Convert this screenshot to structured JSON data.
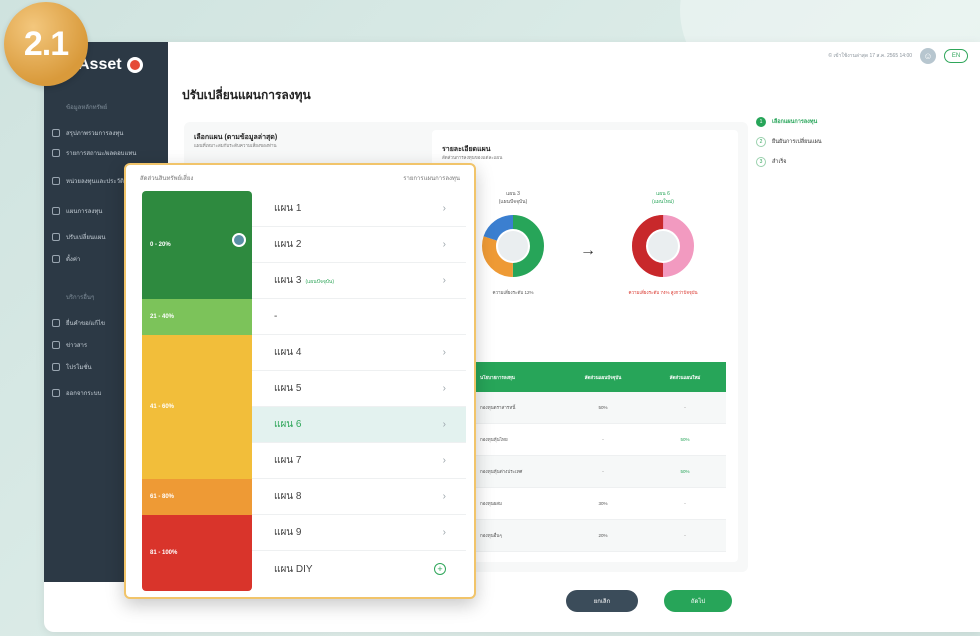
{
  "step_badge": "2.1",
  "app": {
    "logo_text": "Asset"
  },
  "header": {
    "last_login": "© เข้าใช้งานล่าสุด 17 ส.ค. 2565 14:00",
    "lang": "EN"
  },
  "sidebar": {
    "section1": "ข้อมูลหลักทรัพย์",
    "items": [
      {
        "label": "สรุปภาพรวมการลงทุน"
      },
      {
        "label": "รายการสถานะ/ผลตอบแทน"
      },
      {
        "label": "หน่วยลงทุนและประวัติ"
      },
      {
        "label": "แผนการลงทุน"
      },
      {
        "label": "ปรับเปลี่ยนแผน"
      },
      {
        "label": "ตั้งค่า"
      }
    ],
    "section2": "บริการอื่นๆ",
    "items2": [
      {
        "label": "ยื่นคำขอ/แก้ไข"
      },
      {
        "label": "ข่าวสาร"
      },
      {
        "label": "โปรโมชั่น"
      },
      {
        "label": "ออกจากระบบ"
      }
    ]
  },
  "page": {
    "title": "ปรับเปลี่ยนแผนการลงทุน",
    "select_label": "เลือกแผน (ตามข้อมูลล่าสุด)",
    "select_sub": "แผนที่เหมาะสมกับระดับความเสี่ยงของท่าน",
    "detail_title": "รายละเอียดแผน",
    "detail_sub": "สัดส่วนการลงทุนของแต่ละแผน",
    "current_plan": {
      "name": "แผน 3",
      "tag": "(แผนปัจจุบัน)",
      "footer": "ความเสี่ยงระดับ 12%"
    },
    "new_plan": {
      "name": "แผน 6",
      "tag": "(แผนใหม่)",
      "footer": "ความเสี่ยงระดับ 74% สูงกว่าปัจจุบัน"
    },
    "table_headers": [
      "นโยบายการลงทุน",
      "สัดส่วนแผนปัจจุบัน",
      "สัดส่วนแผนใหม่"
    ],
    "table_rows": [
      {
        "name": "กองทุนตราสารหนี้",
        "current": "50%",
        "new": "-"
      },
      {
        "name": "กองทุนหุ้นไทย",
        "current": "-",
        "new": "50%"
      },
      {
        "name": "กองทุนหุ้นต่างประเทศ",
        "current": "-",
        "new": "50%"
      },
      {
        "name": "กองทุนผสม",
        "current": "30%",
        "new": "-"
      },
      {
        "name": "กองทุนอื่นๆ",
        "current": "20%",
        "new": "-"
      }
    ]
  },
  "stepper": [
    {
      "num": "1",
      "label": "เลือกแผนการลงทุน"
    },
    {
      "num": "2",
      "label": "ยืนยันการเปลี่ยนแผน"
    },
    {
      "num": "3",
      "label": "สำเร็จ"
    }
  ],
  "buttons": {
    "cancel": "ยกเลิก",
    "next": "ถัดไป"
  },
  "popup": {
    "left_header": "สัดส่วนสินทรัพย์เสี่ยง",
    "right_header": "รายการแผนการลงทุน",
    "risk_bands": [
      "0 - 20%",
      "21 - 40%",
      "41 - 60%",
      "61 - 80%",
      "81 - 100%"
    ],
    "plans": [
      {
        "label": "แผน 1"
      },
      {
        "label": "แผน 2"
      },
      {
        "label": "แผน 3",
        "tag": "(แผนปัจจุบัน)"
      },
      {
        "label": "-"
      },
      {
        "label": "แผน 4"
      },
      {
        "label": "แผน 5"
      },
      {
        "label": "แผน 6"
      },
      {
        "label": "แผน 7"
      },
      {
        "label": "แผน 8"
      },
      {
        "label": "แผน 9"
      },
      {
        "label": "แผน DIY"
      }
    ],
    "selected_plan": "แผน 6"
  },
  "colors": {
    "green": "#27a559",
    "dark_green": "#2e8a3f",
    "light_green": "#7cc35a",
    "yellow": "#f2be3a",
    "orange": "#ee9a35",
    "red": "#d9342b",
    "sidebar": "#2c3945"
  }
}
